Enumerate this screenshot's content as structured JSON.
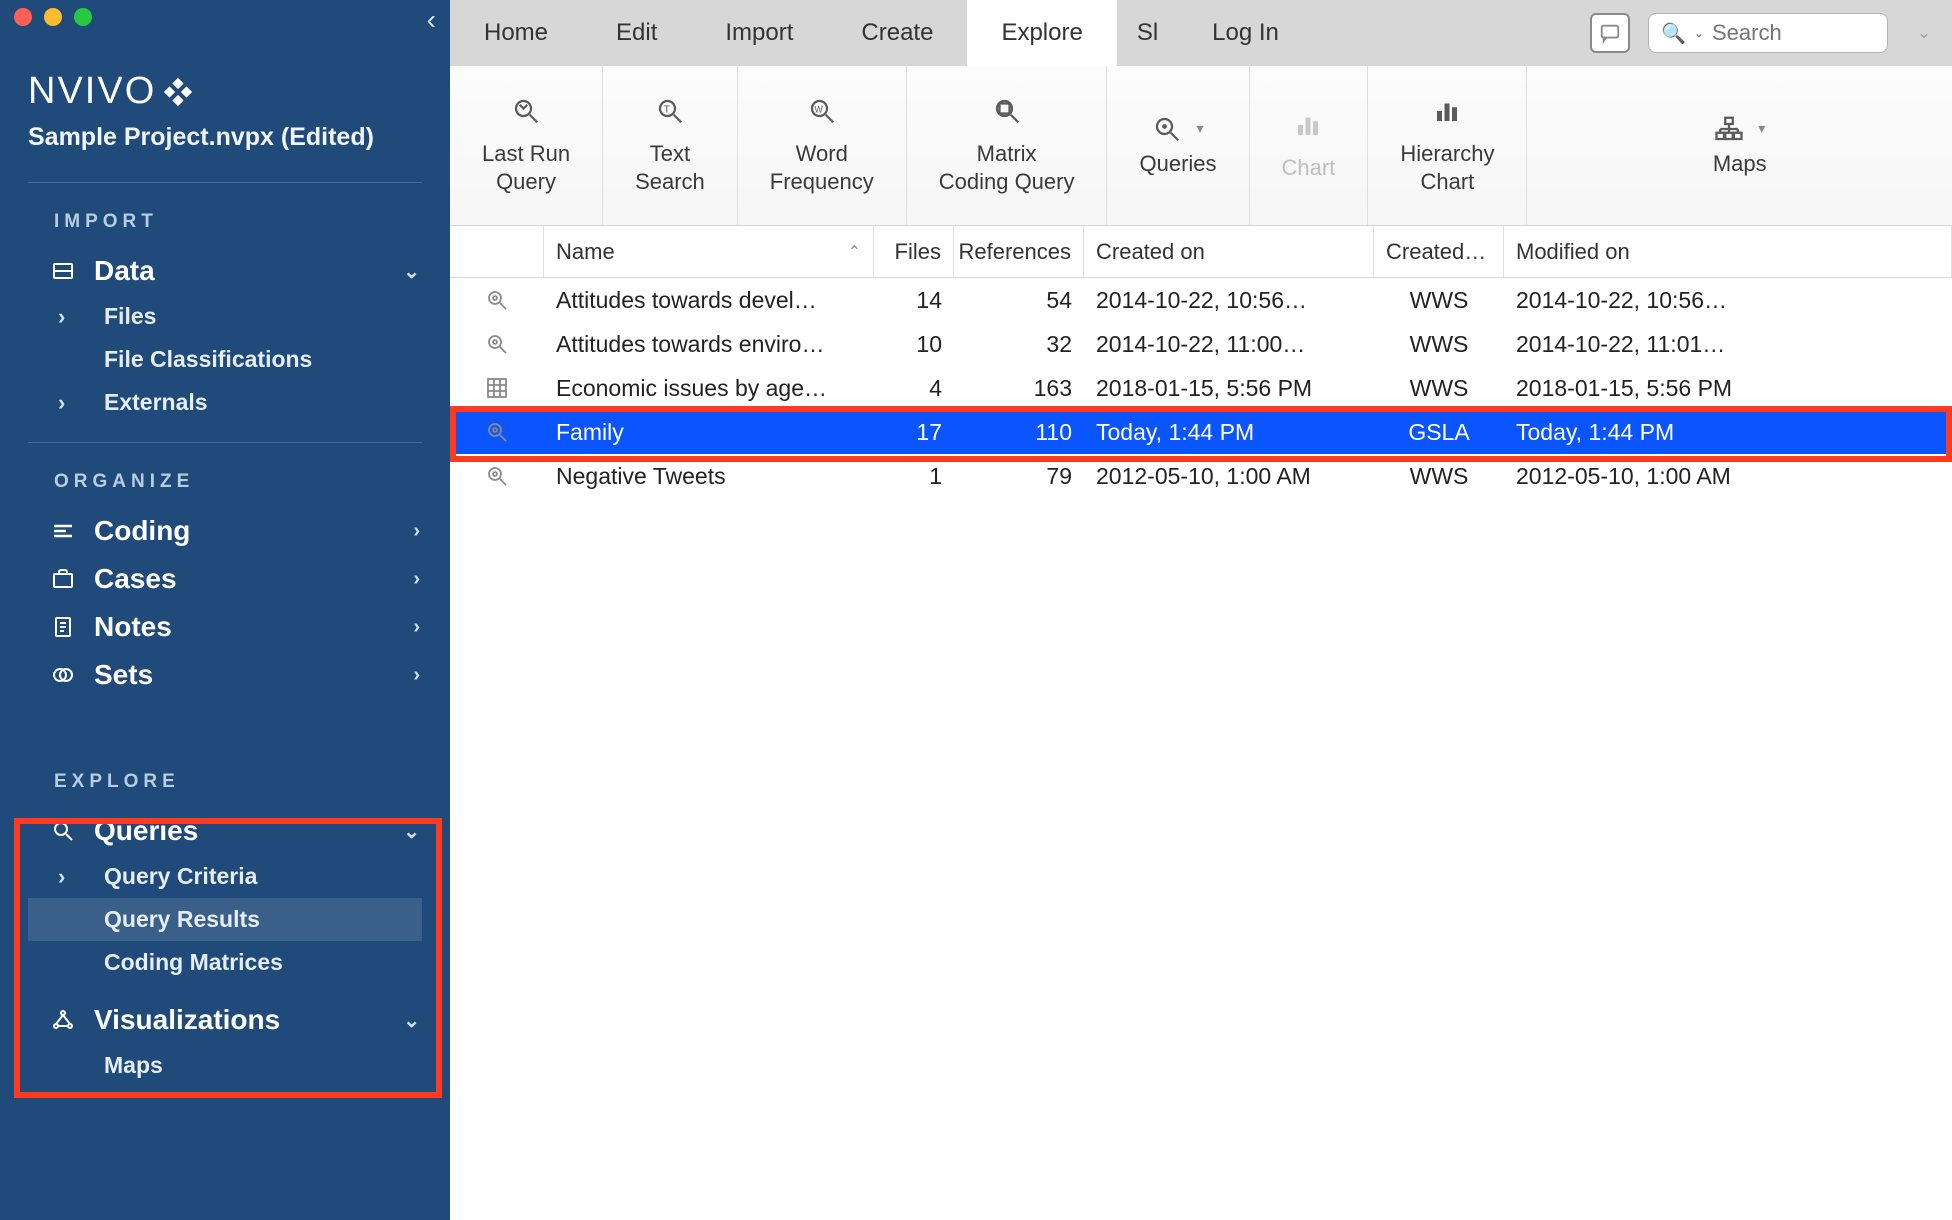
{
  "sidebar": {
    "project_title": "Sample Project.nvpx (Edited)",
    "sections": {
      "import": {
        "label": "IMPORT",
        "data": {
          "label": "Data",
          "expanded": true,
          "children": {
            "files": "Files",
            "file_classifications": "File Classifications",
            "externals": "Externals"
          }
        }
      },
      "organize": {
        "label": "ORGANIZE",
        "coding": "Coding",
        "cases": "Cases",
        "notes": "Notes",
        "sets": "Sets"
      },
      "explore": {
        "label": "EXPLORE",
        "queries": {
          "label": "Queries",
          "expanded": true,
          "children": {
            "query_criteria": "Query Criteria",
            "query_results": "Query Results",
            "coding_matrices": "Coding Matrices"
          }
        },
        "visualizations": {
          "label": "Visualizations",
          "children": {
            "maps": "Maps"
          }
        }
      }
    }
  },
  "tabbar": {
    "tabs": [
      "Home",
      "Edit",
      "Import",
      "Create",
      "Explore",
      "Sl",
      "Log In"
    ],
    "active_index": 4,
    "search_placeholder": "Search"
  },
  "ribbon": {
    "last_run_query": "Last Run\nQuery",
    "text_search": "Text\nSearch",
    "word_frequency": "Word\nFrequency",
    "matrix_coding": "Matrix\nCoding Query",
    "queries": "Queries",
    "chart": "Chart",
    "hierarchy_chart": "Hierarchy\nChart",
    "maps": "Maps"
  },
  "table": {
    "columns": {
      "name": "Name",
      "files": "Files",
      "references": "References",
      "created_on": "Created on",
      "created_by": "Created…",
      "modified_on": "Modified on"
    },
    "rows": [
      {
        "icon": "search-result-icon",
        "name": "Attitudes towards devel…",
        "files": "14",
        "refs": "54",
        "created": "2014-10-22, 10:56…",
        "by": "WWS",
        "modified": "2014-10-22, 10:56…",
        "selected": false
      },
      {
        "icon": "search-result-icon",
        "name": "Attitudes towards enviro…",
        "files": "10",
        "refs": "32",
        "created": "2014-10-22, 11:00…",
        "by": "WWS",
        "modified": "2014-10-22, 11:01…",
        "selected": false
      },
      {
        "icon": "matrix-icon",
        "name": "Economic issues by age…",
        "files": "4",
        "refs": "163",
        "created": "2018-01-15, 5:56 PM",
        "by": "WWS",
        "modified": "2018-01-15, 5:56 PM",
        "selected": false
      },
      {
        "icon": "search-result-icon",
        "name": "Family",
        "files": "17",
        "refs": "110",
        "created": "Today, 1:44 PM",
        "by": "GSLA",
        "modified": "Today, 1:44 PM",
        "selected": true
      },
      {
        "icon": "search-result-icon",
        "name": "Negative Tweets",
        "files": "1",
        "refs": "79",
        "created": "2012-05-10, 1:00 AM",
        "by": "WWS",
        "modified": "2012-05-10, 1:00 AM",
        "selected": false
      }
    ]
  }
}
